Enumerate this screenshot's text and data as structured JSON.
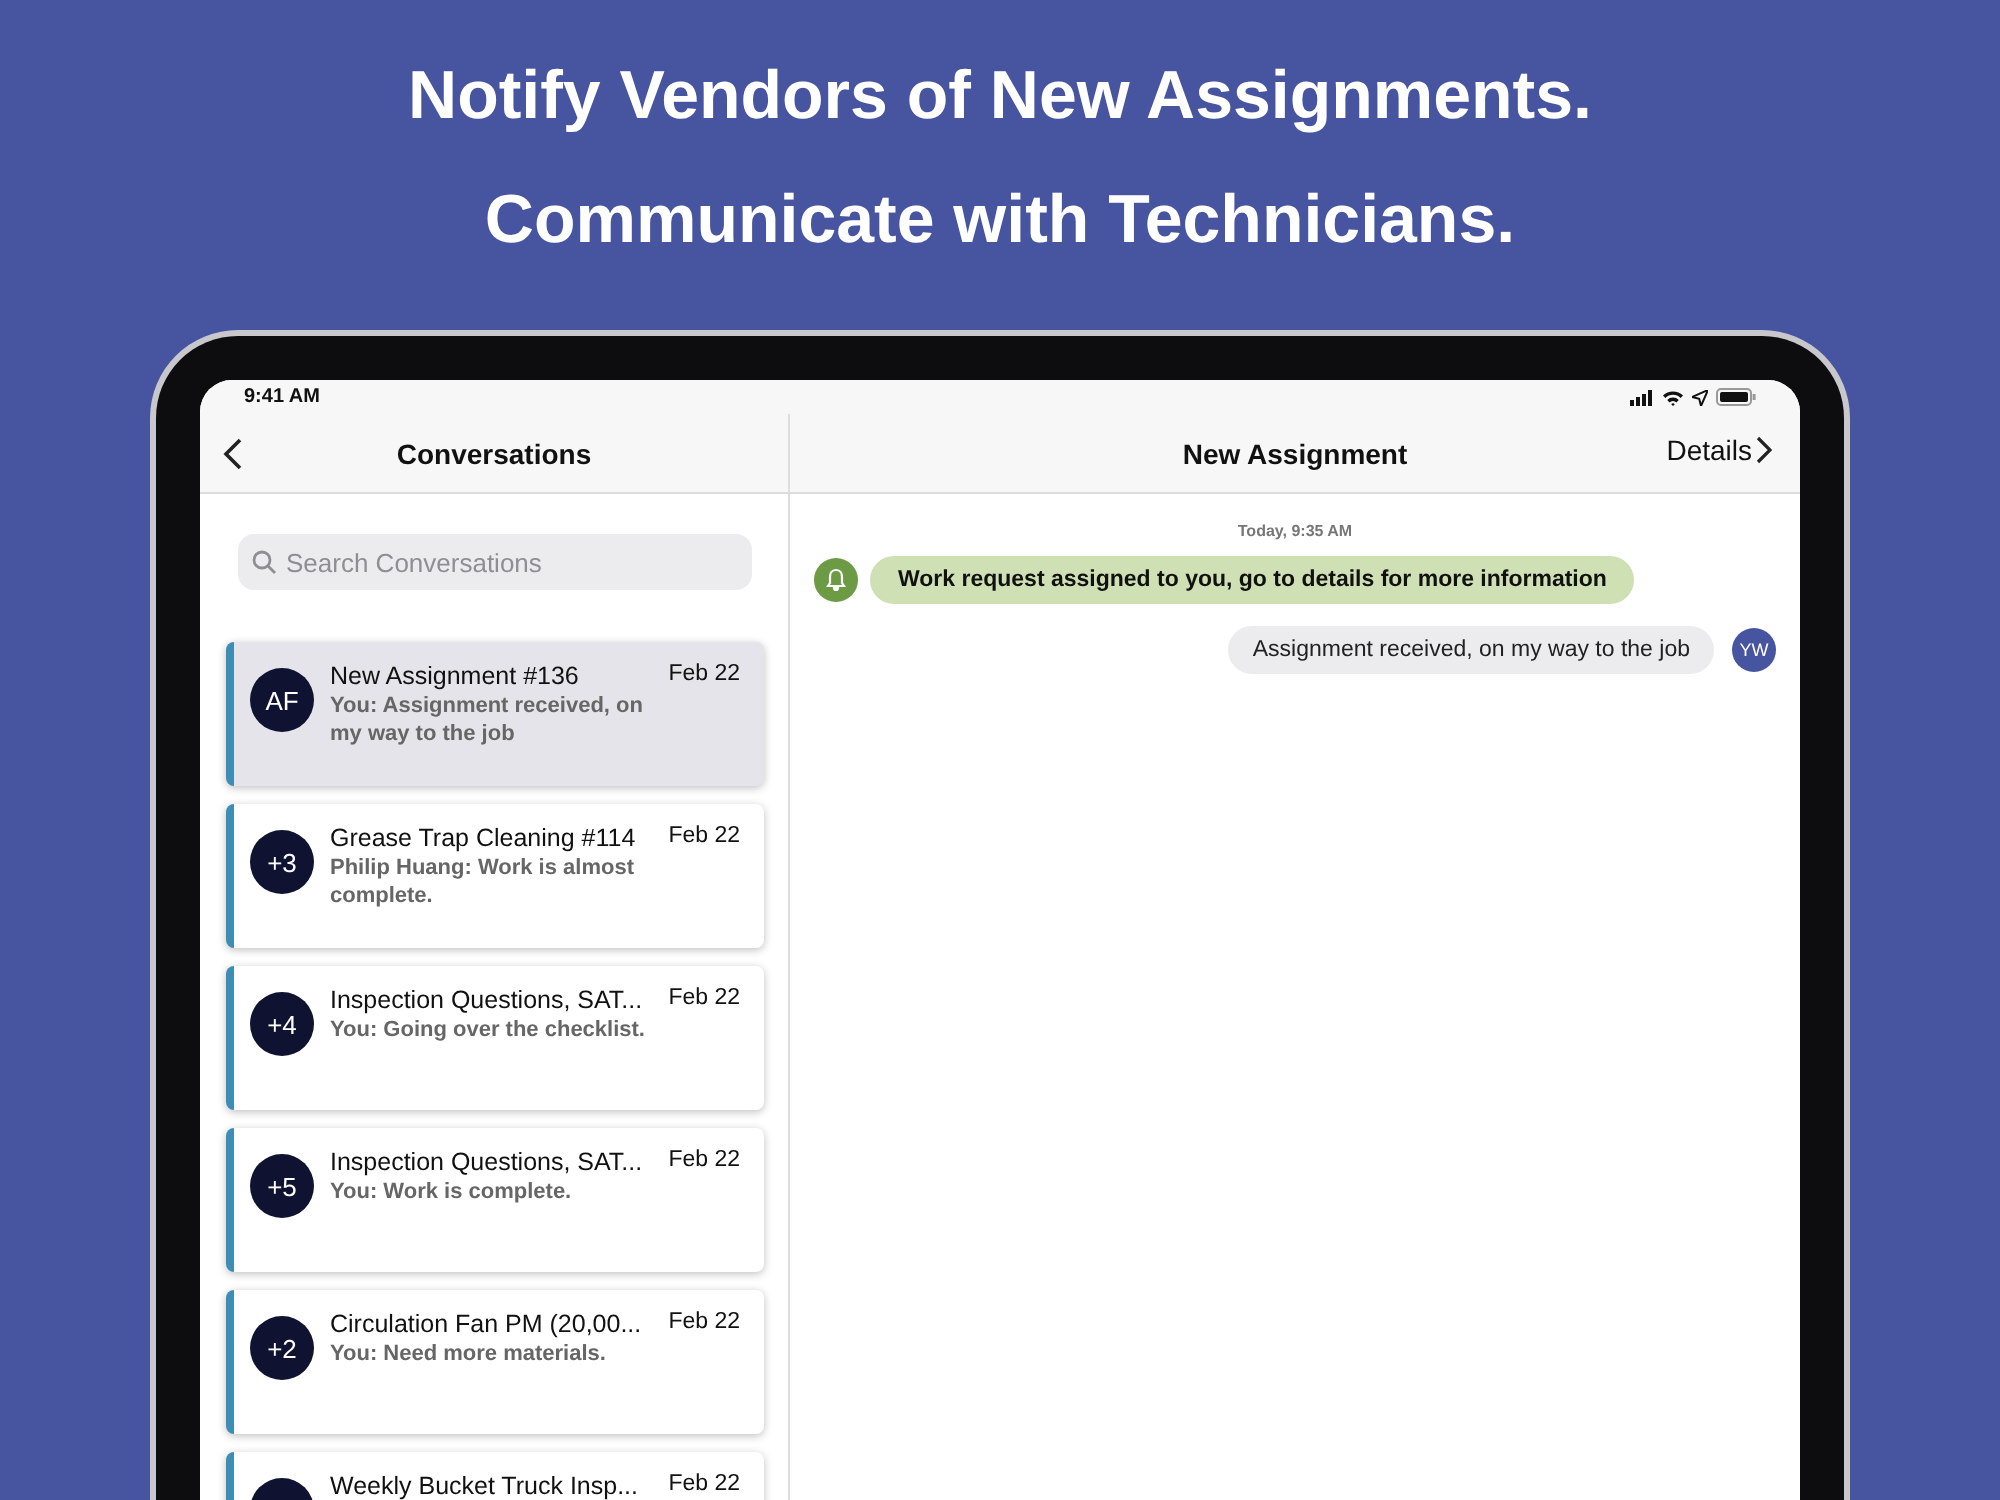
{
  "headlines": [
    "Notify Vendors of New Assignments.",
    "Communicate with Technicians."
  ],
  "status_bar": {
    "time": "9:41 AM"
  },
  "sidebar": {
    "title": "Conversations",
    "search": {
      "placeholder": "Search Conversations"
    },
    "conversations": [
      {
        "avatar": "AF",
        "title": "New Assignment #136",
        "date": "Feb 22",
        "preview": "You: Assignment received, on my way to the job",
        "selected": true
      },
      {
        "avatar": "+3",
        "title": "Grease Trap Cleaning #114",
        "date": "Feb 22",
        "preview": "Philip Huang: Work is almost complete.",
        "selected": false
      },
      {
        "avatar": "+4",
        "title": "Inspection Questions, SAT...",
        "date": "Feb 22",
        "preview": "You: Going over the checklist.",
        "selected": false
      },
      {
        "avatar": "+5",
        "title": "Inspection Questions, SAT...",
        "date": "Feb 22",
        "preview": "You: Work is complete.",
        "selected": false
      },
      {
        "avatar": "+2",
        "title": "Circulation Fan PM (20,00...",
        "date": "Feb 22",
        "preview": "You: Need more materials.",
        "selected": false
      },
      {
        "title": "Weekly Bucket Truck Insp...",
        "date": "Feb 22",
        "selected": false
      }
    ]
  },
  "chat": {
    "title": "New Assignment",
    "details_link": "Details",
    "timestamp": "Today, 9:35 AM",
    "messages": [
      {
        "kind": "system",
        "text": "Work request assigned to you, go to details for more information"
      },
      {
        "kind": "outgoing",
        "text": "Assignment received, on my way to the job",
        "avatar": "YW"
      }
    ]
  }
}
